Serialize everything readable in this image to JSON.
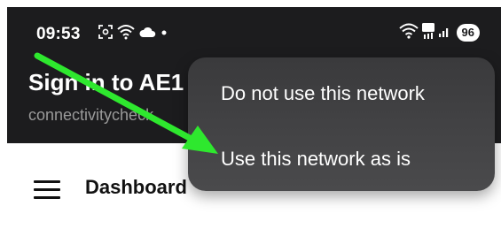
{
  "status_bar": {
    "time": "09:53",
    "battery": "96",
    "icons_left": [
      "screenshot-icon",
      "wifi-icon",
      "cloud-icon",
      "dot-icon"
    ],
    "icons_right": [
      "wifi-icon",
      "5g-signal-icon",
      "cell-signal-icon",
      "battery-icon"
    ]
  },
  "header": {
    "title": "Sign in to AE1",
    "subtitle": "connectivitycheck"
  },
  "nav": {
    "title": "Dashboard",
    "menu_icon": "hamburger-menu-icon"
  },
  "popup_menu": {
    "items": [
      {
        "label": "Do not use this network"
      },
      {
        "label": "Use this network as is"
      }
    ]
  },
  "annotation": {
    "arrow_color": "#2ee82e",
    "points_to": "Use this network as is"
  },
  "colors": {
    "header_bg": "#1c1c1e",
    "popup_bg": "#3a3a3c",
    "subtitle": "#9a9a9a"
  }
}
